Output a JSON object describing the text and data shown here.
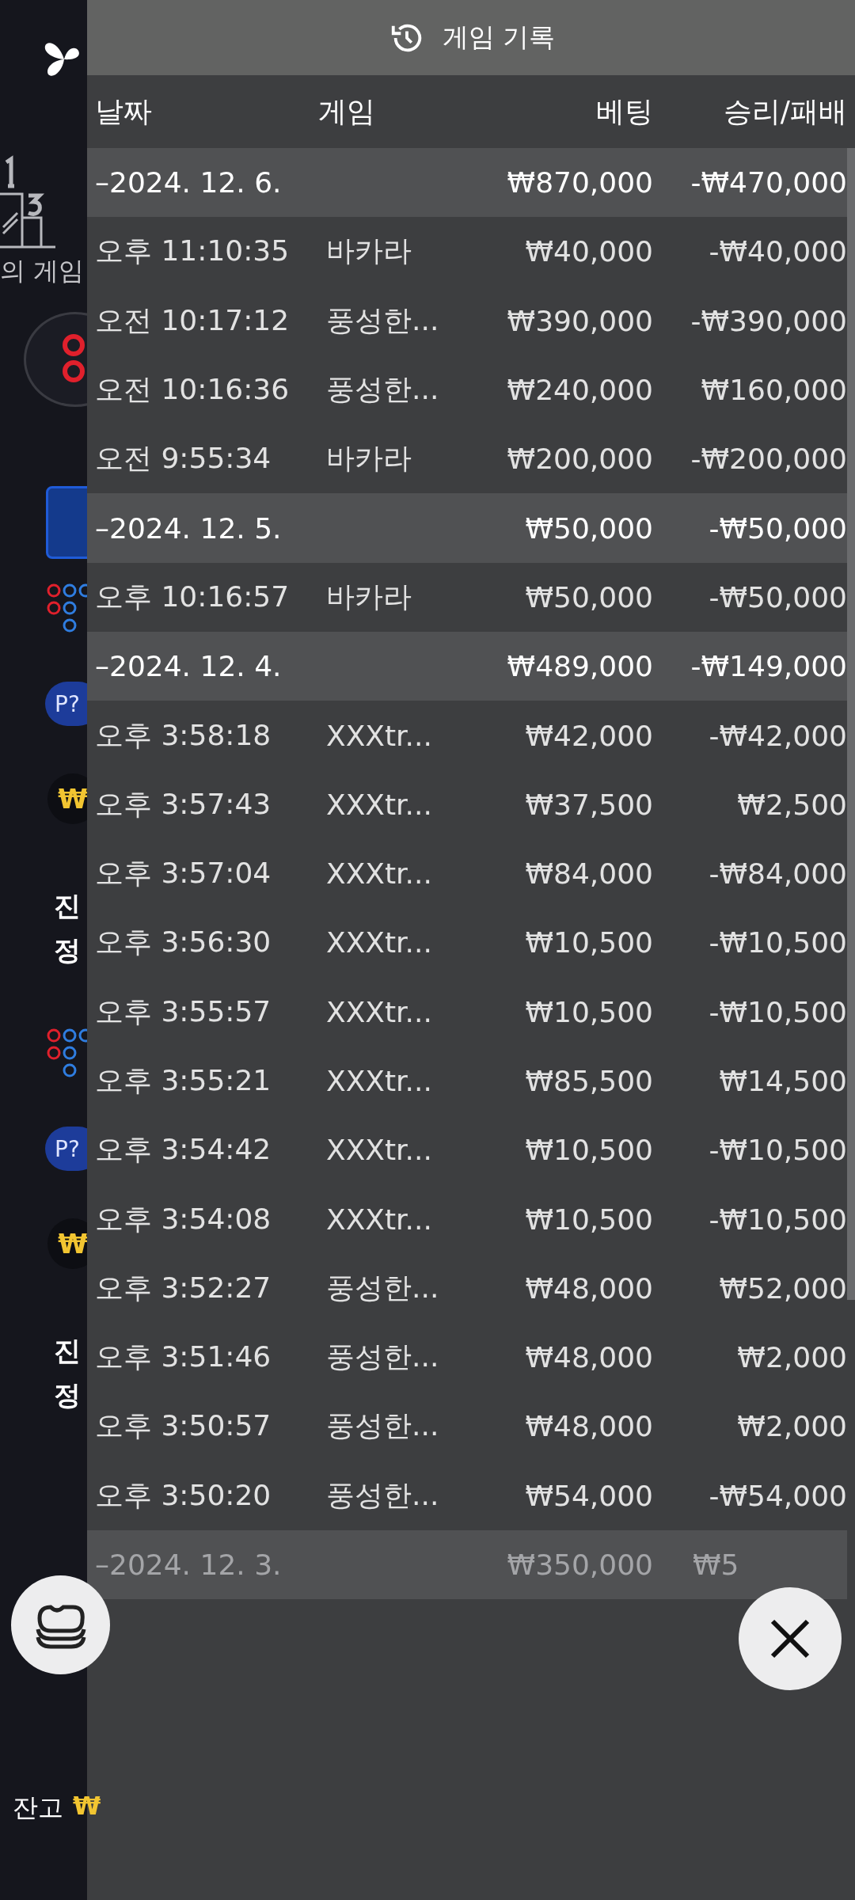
{
  "background": {
    "podium_label": "의 게임",
    "cards": [
      {
        "badge": "P?",
        "currency": "₩",
        "lines": [
          "진",
          "정"
        ]
      },
      {
        "badge": "P?",
        "currency": "₩",
        "lines": [
          "진",
          "정"
        ]
      }
    ],
    "balance_label": "잔고",
    "balance_value": "₩"
  },
  "history": {
    "title": "게임 기록",
    "columns": [
      "날짜",
      "게임",
      "베팅",
      "승리/패배"
    ],
    "groups": [
      {
        "date": "–2024. 12. 6.",
        "bet": "₩870,000",
        "result": "-₩470,000",
        "rows": [
          {
            "time": "오후 11:10:35",
            "game": "바카라",
            "bet": "₩40,000",
            "result": "-₩40,000"
          },
          {
            "time": "오전 10:17:12",
            "game": "풍성한...",
            "bet": "₩390,000",
            "result": "-₩390,000"
          },
          {
            "time": "오전 10:16:36",
            "game": "풍성한...",
            "bet": "₩240,000",
            "result": "₩160,000"
          },
          {
            "time": "오전 9:55:34",
            "game": "바카라",
            "bet": "₩200,000",
            "result": "-₩200,000"
          }
        ]
      },
      {
        "date": "–2024. 12. 5.",
        "bet": "₩50,000",
        "result": "-₩50,000",
        "rows": [
          {
            "time": "오후 10:16:57",
            "game": "바카라",
            "bet": "₩50,000",
            "result": "-₩50,000"
          }
        ]
      },
      {
        "date": "–2024. 12. 4.",
        "bet": "₩489,000",
        "result": "-₩149,000",
        "rows": [
          {
            "time": "오후 3:58:18",
            "game": "XXXtr...",
            "bet": "₩42,000",
            "result": "-₩42,000"
          },
          {
            "time": "오후 3:57:43",
            "game": "XXXtr...",
            "bet": "₩37,500",
            "result": "₩2,500"
          },
          {
            "time": "오후 3:57:04",
            "game": "XXXtr...",
            "bet": "₩84,000",
            "result": "-₩84,000"
          },
          {
            "time": "오후 3:56:30",
            "game": "XXXtr...",
            "bet": "₩10,500",
            "result": "-₩10,500"
          },
          {
            "time": "오후 3:55:57",
            "game": "XXXtr...",
            "bet": "₩10,500",
            "result": "-₩10,500"
          },
          {
            "time": "오후 3:55:21",
            "game": "XXXtr...",
            "bet": "₩85,500",
            "result": "₩14,500"
          },
          {
            "time": "오후 3:54:42",
            "game": "XXXtr...",
            "bet": "₩10,500",
            "result": "-₩10,500"
          },
          {
            "time": "오후 3:54:08",
            "game": "XXXtr...",
            "bet": "₩10,500",
            "result": "-₩10,500"
          },
          {
            "time": "오후 3:52:27",
            "game": "풍성한...",
            "bet": "₩48,000",
            "result": "₩52,000"
          },
          {
            "time": "오후 3:51:46",
            "game": "풍성한...",
            "bet": "₩48,000",
            "result": "₩2,000"
          },
          {
            "time": "오후 3:50:57",
            "game": "풍성한...",
            "bet": "₩48,000",
            "result": "₩2,000"
          },
          {
            "time": "오후 3:50:20",
            "game": "풍성한...",
            "bet": "₩54,000",
            "result": "-₩54,000"
          }
        ]
      },
      {
        "date": "–2024. 12. 3.",
        "bet": "₩350,000",
        "result": "₩5"
      }
    ]
  }
}
